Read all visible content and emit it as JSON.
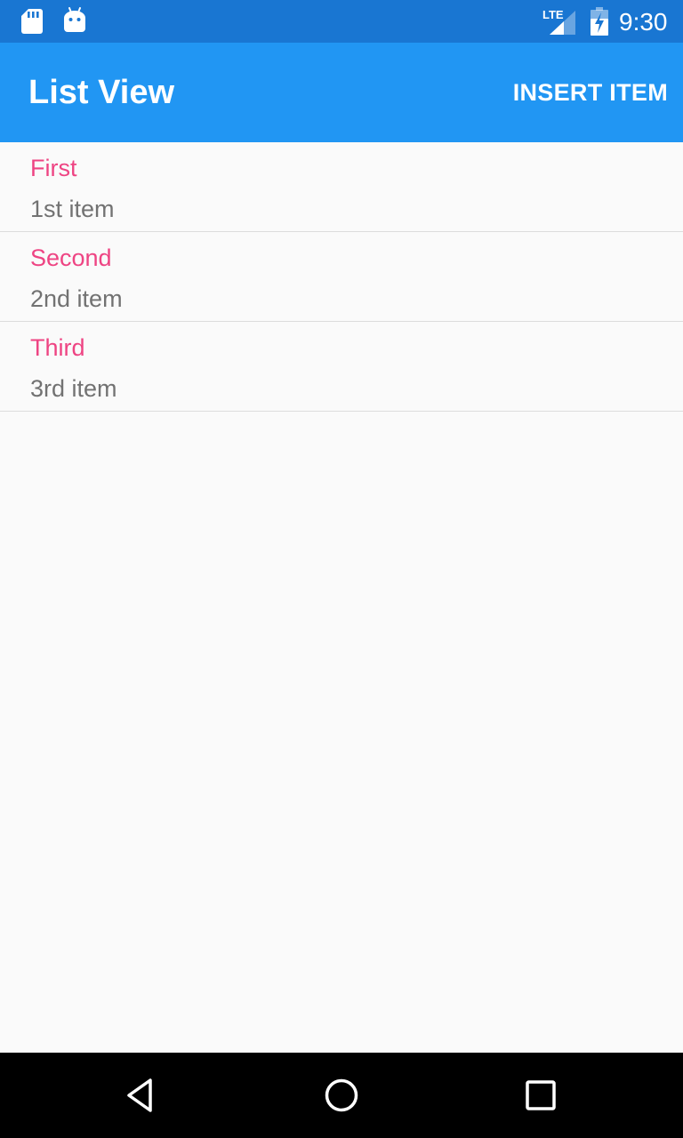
{
  "status_bar": {
    "time": "9:30",
    "network_label": "LTE",
    "icons": [
      "sd-card-icon",
      "android-icon",
      "lte-signal-icon",
      "battery-charging-icon"
    ]
  },
  "app_bar": {
    "title": "List View",
    "action_label": "INSERT ITEM",
    "color": "#2196f3"
  },
  "list": {
    "items": [
      {
        "title": "First",
        "subtitle": "1st item"
      },
      {
        "title": "Second",
        "subtitle": "2nd item"
      },
      {
        "title": "Third",
        "subtitle": "3rd item"
      }
    ],
    "title_color": "#ee4483",
    "subtitle_color": "#727272"
  },
  "nav_bar": {
    "icons": [
      "back-icon",
      "home-icon",
      "recents-icon"
    ]
  }
}
